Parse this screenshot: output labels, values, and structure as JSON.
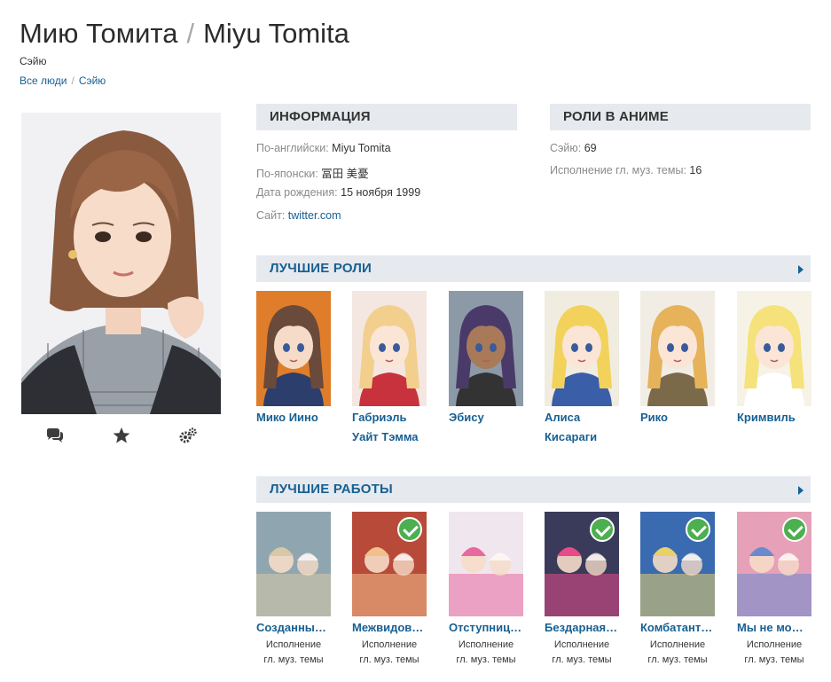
{
  "header": {
    "title_ru": "Мию Томита",
    "title_sep": "/",
    "title_en": "Miyu Tomita",
    "subtitle": "Сэйю",
    "breadcrumb": [
      {
        "label": "Все люди"
      },
      {
        "label": "Сэйю"
      }
    ],
    "breadcrumb_sep": "/"
  },
  "actions": [
    {
      "icon": "comments-icon"
    },
    {
      "icon": "star-icon"
    },
    {
      "icon": "gears-icon"
    }
  ],
  "info": {
    "heading": "Информация",
    "rows": [
      {
        "label": "По-английски:",
        "value": "Miyu Tomita"
      },
      {
        "label": "По-японски:",
        "value": "冨田 美憂"
      },
      {
        "label": "Дата рождения:",
        "value": "15 ноября 1999"
      },
      {
        "label": "Сайт:",
        "value": "twitter.com"
      }
    ]
  },
  "roles": {
    "heading": "Роли в аниме",
    "rows": [
      {
        "label": "Сэйю:",
        "value": "69"
      },
      {
        "label": "Исполнение гл. муз. темы:",
        "value": "16"
      }
    ]
  },
  "best_roles": {
    "heading": "Лучшие роли",
    "items": [
      {
        "name": "Мико Иино",
        "hair": "#6a4a3a",
        "bg": "#e07d2b",
        "skin": "#f6dcc8",
        "cloth": "#2c3e6b"
      },
      {
        "name": "Габриэль Уайт Тэмма",
        "hair": "#f3cf8e",
        "bg": "#f4e6e0",
        "skin": "#fbe5d6",
        "cloth": "#c8323c"
      },
      {
        "name": "Эбису",
        "hair": "#4a3a6a",
        "bg": "#8c9aa8",
        "skin": "#a87a5a",
        "cloth": "#333333"
      },
      {
        "name": "Алиса Кисараги",
        "hair": "#f2d25a",
        "bg": "#f1ece0",
        "skin": "#fbe5d6",
        "cloth": "#3a5ea8"
      },
      {
        "name": "Рико",
        "hair": "#e6b25a",
        "bg": "#f2ede4",
        "skin": "#fbe5d6",
        "cloth": "#7a6a4a"
      },
      {
        "name": "Кримвиль",
        "hair": "#f6e27a",
        "bg": "#f6f3e6",
        "skin": "#fbe5d6",
        "cloth": "#ffffff"
      }
    ]
  },
  "best_works": {
    "heading": "Лучшие работы",
    "items": [
      {
        "title": "Созданны…",
        "role_1": "Исполнение",
        "role_2": "гл. муз. темы",
        "watched": false,
        "bg": "#8fa6b0",
        "accent": "#d8c8a8"
      },
      {
        "title": "Межвидов…",
        "role_1": "Исполнение",
        "role_2": "гл. муз. темы",
        "watched": true,
        "bg": "#b84a3a",
        "accent": "#f2c08a"
      },
      {
        "title": "Отступниц…",
        "role_1": "Исполнение",
        "role_2": "гл. муз. темы",
        "watched": false,
        "bg": "#f0e6ee",
        "accent": "#e868a0"
      },
      {
        "title": "Бездарная…",
        "role_1": "Исполнение",
        "role_2": "гл. муз. темы",
        "watched": true,
        "bg": "#3a3a5a",
        "accent": "#e84a8a"
      },
      {
        "title": "Комбатант…",
        "role_1": "Исполнение",
        "role_2": "гл. муз. темы",
        "watched": true,
        "bg": "#3a6ab0",
        "accent": "#e8d06a"
      },
      {
        "title": "Мы не мо…",
        "role_1": "Исполнение",
        "role_2": "гл. муз. темы",
        "watched": true,
        "bg": "#e6a0b8",
        "accent": "#6a8ad0"
      }
    ]
  },
  "colors": {
    "link": "#176093",
    "section_bg": "#e6e9ee",
    "check": "#4caf50"
  }
}
